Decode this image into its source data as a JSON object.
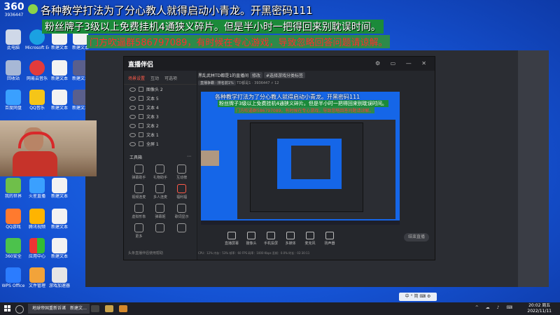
{
  "overlay": {
    "logo": "360",
    "logo_sub": "3936447",
    "line1": "各种教学打法为了分心教人就得启动小青龙。开黑密码111",
    "line2": "粉丝牌子3级以上免费挂机4通狭义碎片。但是半小时一把得回来别耽误时间。",
    "line3": "门方吹逼群586797089，有时候在专心游戏，导致忽略回答问题请谅解。"
  },
  "app": {
    "brand": "直播伴侣",
    "tabs": [
      "场景设置",
      "互动",
      "可选项"
    ],
    "scene_items": [
      {
        "label": "图像头 2"
      },
      {
        "label": "文本 5"
      },
      {
        "label": "文本 4"
      },
      {
        "label": "文本 3"
      },
      {
        "label": "文本 2"
      },
      {
        "label": "文本 1"
      },
      {
        "label": "全屏 1"
      }
    ],
    "toolbox_title": "工具箱",
    "tools": [
      {
        "label": "弹幕助手"
      },
      {
        "label": "礼物助手"
      },
      {
        "label": "互动榜"
      },
      {
        "label": "视频连麦"
      },
      {
        "label": "多人连麦"
      },
      {
        "label": "福利福"
      },
      {
        "label": "虚拟形象"
      },
      {
        "label": "弹幕姬"
      },
      {
        "label": "歌词显示"
      },
      {
        "label": "更多"
      },
      {
        "label": ""
      },
      {
        "label": ""
      }
    ],
    "left_footer": "头条直播伴侣使用帮助",
    "stream_title": "黑乱武林TD都是1的直播间",
    "edit_label": "修改",
    "category": "#选择游戏分类标签",
    "meta_badge": "直播争霸 · 排名前1%",
    "meta_id": "TD都是1 · 3936447",
    "meta_count": "12",
    "bottom_buttons": [
      {
        "label": "直播屏幕"
      },
      {
        "label": "摄像头"
      },
      {
        "label": "手机投屏"
      },
      {
        "label": "多媒体"
      },
      {
        "label": "麦克风"
      },
      {
        "label": "扬声器"
      }
    ],
    "go_live": "结束直播",
    "stats": "CPU：12%  内存：53%  帧率：60 FPS  码率：1000 Kbps  丢帧：0.0%  时长：02:30:11"
  },
  "taskbar": {
    "item1": "地球帝国重新诉诸",
    "item2": "新建文…",
    "time": "20:02 周五",
    "date": "2022/11/11",
    "ime": "中 ° 简 ⌨ ⚙"
  },
  "desktop_icons": [
    {
      "label": "此电脑"
    },
    {
      "label": "Microsoft Edge"
    },
    {
      "label": "新建文本"
    },
    {
      "label": "新建文本"
    },
    {
      "label": "回收站"
    },
    {
      "label": "网易云音乐"
    },
    {
      "label": "新建文本"
    },
    {
      "label": "新建文本"
    },
    {
      "label": "百度网盘"
    },
    {
      "label": "QQ音乐"
    },
    {
      "label": "新建文本"
    },
    {
      "label": "新建文本"
    },
    {
      "label": "我的世界"
    },
    {
      "label": "火星直播"
    },
    {
      "label": "新建文本"
    },
    {
      "label": "QQ游戏"
    },
    {
      "label": "腾讯视频"
    },
    {
      "label": "新建文本"
    },
    {
      "label": "360安全"
    },
    {
      "label": "应用中心"
    },
    {
      "label": "新建文本"
    },
    {
      "label": "WPS Office"
    },
    {
      "label": "文件管理"
    },
    {
      "label": "游戏加速器"
    }
  ],
  "colors": {
    "desktop_blue": "#1566e8",
    "accent_red": "#ff5b4a",
    "banner_green": "#1b8a3a",
    "banner_red_text": "#ff2d2d"
  }
}
